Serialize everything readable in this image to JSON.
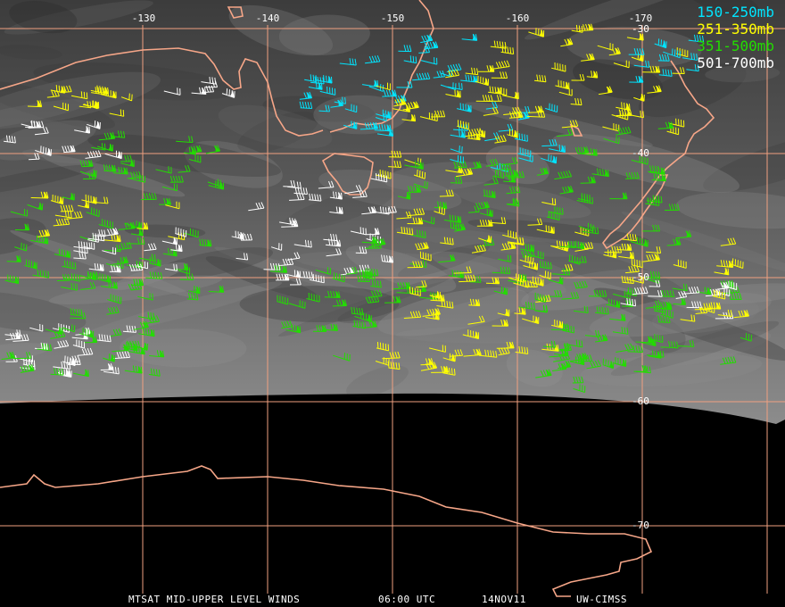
{
  "colors": {
    "grid": "#f0a080",
    "coast": "#f6a688",
    "sat_top": "#4a4a4a",
    "sat_bottom": "#9a9a9a",
    "space": "#000000",
    "layer_150_250": "#00e5ff",
    "layer_251_350": "#ffff00",
    "layer_351_500": "#22dd00",
    "layer_501_700": "#ffffff"
  },
  "longitude_labels": [
    "-130",
    "-140",
    "-150",
    "-160",
    "-170"
  ],
  "latitude_labels": [
    "-30",
    "-40",
    "-50",
    "-60",
    "-70"
  ],
  "legend": [
    {
      "label": "150-250mb",
      "color_key": "layer_150_250"
    },
    {
      "label": "251-350mb",
      "color_key": "layer_251_350"
    },
    {
      "label": "351-500mb",
      "color_key": "layer_351_500"
    },
    {
      "label": "501-700mb",
      "color_key": "layer_501_700"
    }
  ],
  "footer": {
    "product": "MTSAT MID-UPPER LEVEL WINDS",
    "time": "06:00 UTC",
    "date": "14NOV11",
    "source": "UW-CIMSS"
  }
}
